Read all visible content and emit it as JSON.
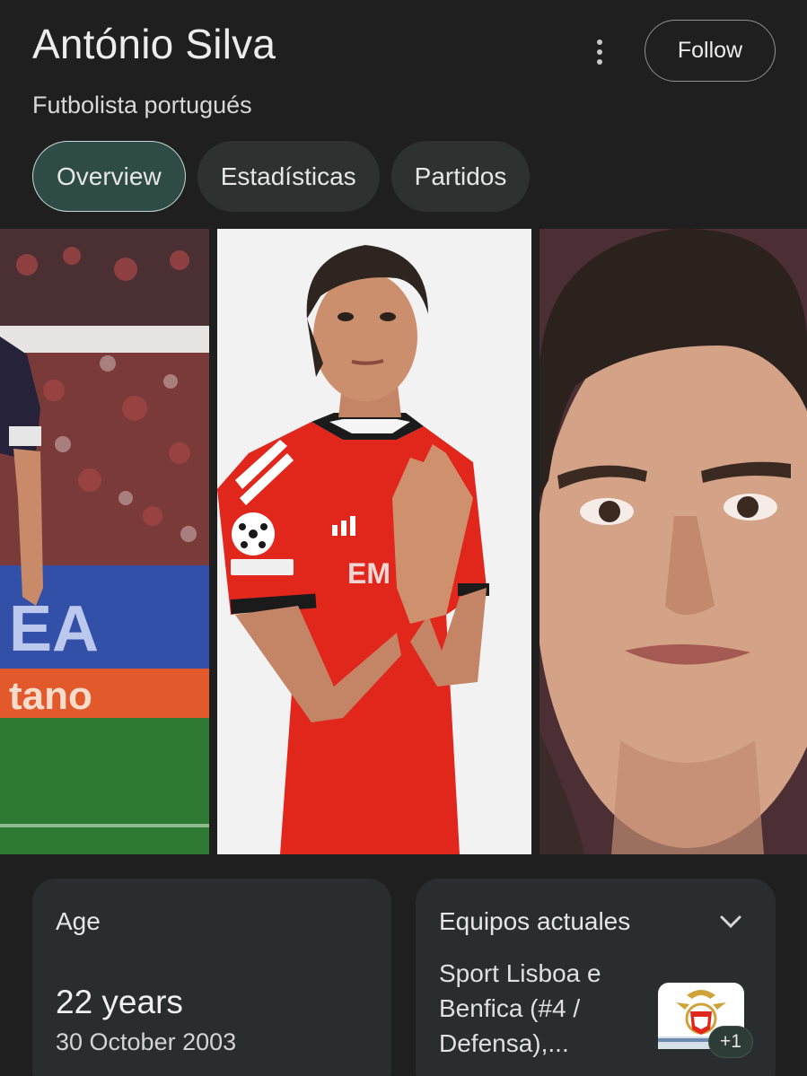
{
  "header": {
    "title": "António Silva",
    "subtitle": "Futbolista portugués",
    "follow_label": "Follow",
    "more_icon": "more-vert-icon"
  },
  "tabs": [
    {
      "label": "Overview",
      "active": true
    },
    {
      "label": "Estadísticas",
      "active": false
    },
    {
      "label": "Partidos",
      "active": false
    }
  ],
  "gallery": {
    "photos": [
      "player-on-pitch-photo",
      "player-red-kit-studio-photo",
      "player-face-closeup-photo"
    ]
  },
  "age_card": {
    "label": "Age",
    "value": "22 years",
    "birth_date": "30 October 2003"
  },
  "teams_card": {
    "label": "Equipos actuales",
    "team": "Sport Lisboa e Benfica (#4 / Defensa),...",
    "more_count": "+1",
    "logo_icon": "benfica-crest-icon",
    "expand_icon": "chevron-down-icon"
  },
  "colors": {
    "background": "#1f1f1f",
    "tab_active_bg": "#2f4b46",
    "tab_bg": "#2d3130",
    "card_bg": "#2a2d2d",
    "benfica_red": "#e1261c"
  }
}
